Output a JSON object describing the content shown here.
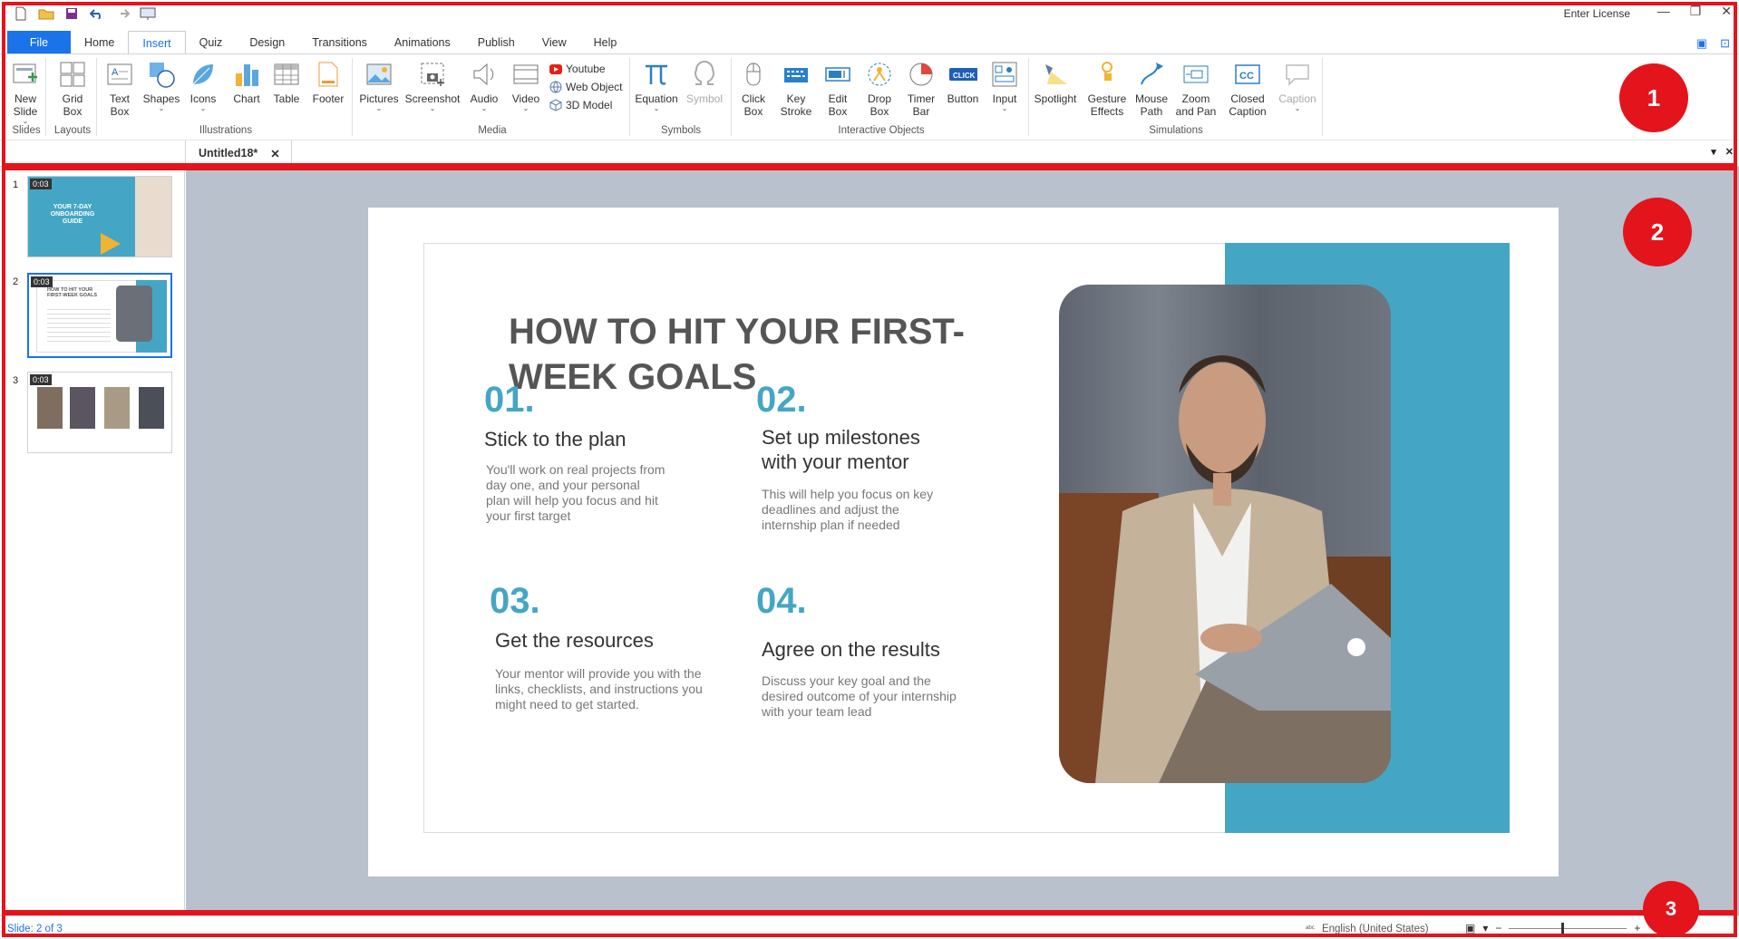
{
  "titlebar": {
    "license": "Enter License",
    "qat_icons": [
      "new-icon",
      "open-icon",
      "save-icon",
      "undo-icon",
      "redo-icon",
      "preview-icon"
    ]
  },
  "tabs": [
    "File",
    "Home",
    "Insert",
    "Quiz",
    "Design",
    "Transitions",
    "Animations",
    "Publish",
    "View",
    "Help"
  ],
  "active_tab": "Insert",
  "ribbon": {
    "new_slide": "New\nSlide",
    "grid_box": "Grid\nBox",
    "text_box": "Text\nBox",
    "shapes": "Shapes",
    "icons": "Icons",
    "chart": "Chart",
    "table": "Table",
    "footer": "Footer",
    "pictures": "Pictures",
    "screenshot": "Screenshot",
    "audio": "Audio",
    "video": "Video",
    "youtube": "Youtube",
    "web_object": "Web Object",
    "model_3d": "3D Model",
    "equation": "Equation",
    "symbol": "Symbol",
    "click_box": "Click\nBox",
    "key_stroke": "Key\nStroke",
    "edit_box": "Edit\nBox",
    "drop_box": "Drop\nBox",
    "timer_bar": "Timer\nBar",
    "button": "Button",
    "input": "Input",
    "spotlight": "Spotlight",
    "gesture_effects": "Gesture\nEffects",
    "mouse_path": "Mouse\nPath",
    "zoom_pan": "Zoom\nand Pan",
    "closed_caption": "Closed\nCaption",
    "caption": "Caption",
    "groups": {
      "slides": "Slides",
      "layouts": "Layouts",
      "illustrations": "Illustrations",
      "media": "Media",
      "symbols": "Symbols",
      "interactive": "Interactive Objects",
      "simulations": "Simulations"
    }
  },
  "document": {
    "tab_title": "Untitled18*",
    "close": "✕"
  },
  "slides_panel": [
    {
      "number": "1",
      "duration": "0:03",
      "title": "YOUR 7-DAY ONBOARDING GUIDE"
    },
    {
      "number": "2",
      "duration": "0:03",
      "title": "HOW TO HIT YOUR FIRST-WEEK GOALS"
    },
    {
      "number": "3",
      "duration": "0:03",
      "title": ""
    }
  ],
  "slide": {
    "headline": "HOW TO HIT YOUR FIRST-WEEK GOALS",
    "items": [
      {
        "num": "01.",
        "title": "Stick to the plan",
        "desc": "You'll work on real projects from day one, and your personal plan will help you focus and hit your first target"
      },
      {
        "num": "02.",
        "title": "Set up milestones with your mentor",
        "desc": "This will help you focus on key deadlines and adjust the internship plan if needed"
      },
      {
        "num": "03.",
        "title": "Get the resources",
        "desc": "Your mentor will provide you with the links, checklists, and instructions you might need to get started."
      },
      {
        "num": "04.",
        "title": "Agree on the results",
        "desc": "Discuss your key goal and the desired outcome of your internship with your team lead"
      }
    ],
    "accent_color": "#44a6c4"
  },
  "status": {
    "slide_counter": "Slide: 2 of 3",
    "language": "English (United States)",
    "zoom_minus": "−",
    "zoom_plus": "+"
  },
  "annotations": [
    "1",
    "2",
    "3"
  ],
  "colors": {
    "brand": "#1a73e8",
    "annotation": "#e3141c",
    "canvas_bg": "#b8c1cc"
  }
}
